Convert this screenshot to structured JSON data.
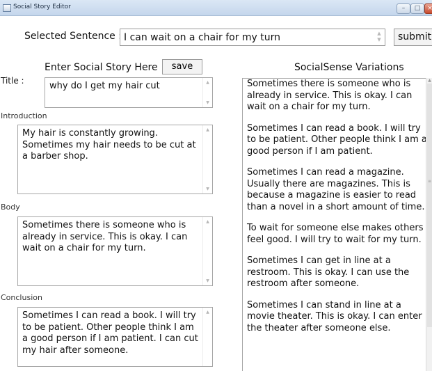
{
  "window": {
    "title": "Social Story Editor",
    "minimize_glyph": "–",
    "maximize_glyph": "□",
    "close_glyph": "×"
  },
  "selected_sentence": {
    "label": "Selected Sentence :",
    "value": "I can wait on a chair for my turn",
    "submit_label": "submit"
  },
  "editor": {
    "heading": "Enter Social Story Here",
    "save_label": "save",
    "title_label": "Title :",
    "title_value": "why do I get my hair cut",
    "introduction_label": "Introduction",
    "introduction_text": "My hair is constantly growing. Sometimes my hair needs to be cut at a barber shop.",
    "body_label": "Body",
    "body_text": "Sometimes there is someone who is already in service. This is okay. I can wait on a chair for my turn.",
    "conclusion_label": "Conclusion",
    "conclusion_text": "Sometimes I can read a book. I will try to be patient. Other people think I am a good person if I am patient. I can cut my hair after someone."
  },
  "variations": {
    "heading": "SocialSense Variations",
    "items": [
      "Sometimes there is someone who is already in service. This is okay. I can wait on a chair for my turn.",
      "Sometimes I can read a book. I will try to be patient. Other people think I am a good person if I am patient.",
      "Sometimes I can read a magazine. Usually there are magazines. This is because a magazine is easier to read than a novel in a short amount of time.",
      "To wait for someone else makes others feel good. I will try to wait for my turn.",
      "Sometimes I can get in line at a restroom. This is okay. I can use the restroom after someone.",
      "Sometimes I can stand in line at a movie theater. This is okay. I can enter the theater after someone else."
    ]
  }
}
